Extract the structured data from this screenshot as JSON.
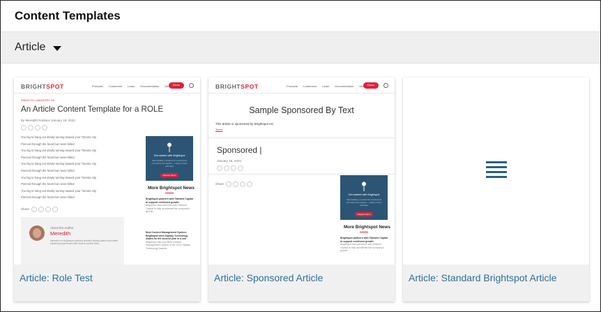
{
  "header": {
    "title": "Content Templates"
  },
  "filter": {
    "selected": "Article"
  },
  "icons": {
    "dropdown": "caret-down-icon",
    "standard": "lines-icon"
  },
  "colors": {
    "link": "#2f6f9a",
    "brand_red": "#e02238",
    "promo_blue": "#2c5575"
  },
  "cards": [
    {
      "title": "Article: Role Test",
      "thumb": {
        "logo": "BRIGHTSPOT",
        "nav": [
          "Products",
          "Customers",
          "Learn",
          "Documentation",
          "About Us"
        ],
        "nav_button": "Demo",
        "breadcrumb": "INSIGHTS  >  INDUSTRY 101",
        "headline": "An Article Content Template for a ROLE",
        "byline": "By Meredith Robbins  January 18, 2023",
        "body_lines": [
          "You big to hang out slowly turning toward your Toronto city",
          "Pierced through the heart but never killed",
          "You big to hang out slowly turning toward your Toronto city",
          "Pierced through the heart but never killed",
          "You big to hang out slowly turning toward your Toronto city",
          "Pierced through the heart but never killed",
          "You big to hang out slowly turning toward your Toronto city",
          "Pierced through the heart but never killed",
          "You big to hang out slowly turning toward your Toronto city",
          "Pierced through the heart but never killed"
        ],
        "share_label": "Share",
        "promo_title": "Get started with Brightspot",
        "promo_text": "Start building a content-rich environment your teams can support — today in hours and days",
        "promo_button": "Request Demo",
        "more_news": "More Brightspot News",
        "news_items": [
          {
            "title": "Brightspot partners with Tailwind Capital to support continued growth",
            "body": "Brightspot has partnered with Tailwind Capital to help accelerate the company's growth."
          },
          {
            "title": "Best Content Management System: Brightspot wins Digiday Technology Award for the second year in a row",
            "body": "Brightspot has won Best Content Management System in the 2021 Digiday Technology Awards."
          }
        ],
        "about_label": "About the Author",
        "author_name": "Meredith",
        "author_bio": "Meredith is a Brightspot solutions architect helping teams build better publishing experiences with modern content tools."
      }
    },
    {
      "title": "Article: Sponsored Article",
      "thumb": {
        "logo": "BRIGHTSPOT",
        "nav": [
          "Products",
          "Customers",
          "Learn",
          "Documentation",
          "About Us"
        ],
        "nav_button": "Demo",
        "headline": "Sample Sponsored By Text",
        "sponsor_line": "This article is sponsored by Brightspot Inc.",
        "sponsor_link": "Terms",
        "sponsored_label": "Sponsored |",
        "date": "January 18, 2023",
        "share_label": "Share",
        "promo_title": "Get started with Brightspot",
        "promo_text": "Start building a content-rich environment your teams can support — today in hours and days",
        "promo_button": "Request Demo",
        "more_news": "More Brightspot News",
        "news_items": [
          {
            "title": "Brightspot partners with Tailwind Capital to support continued growth",
            "body": "Brightspot has partnered with Tailwind Capital to help accelerate the company's growth."
          }
        ]
      }
    },
    {
      "title": "Article: Standard Brightspot Article"
    }
  ]
}
